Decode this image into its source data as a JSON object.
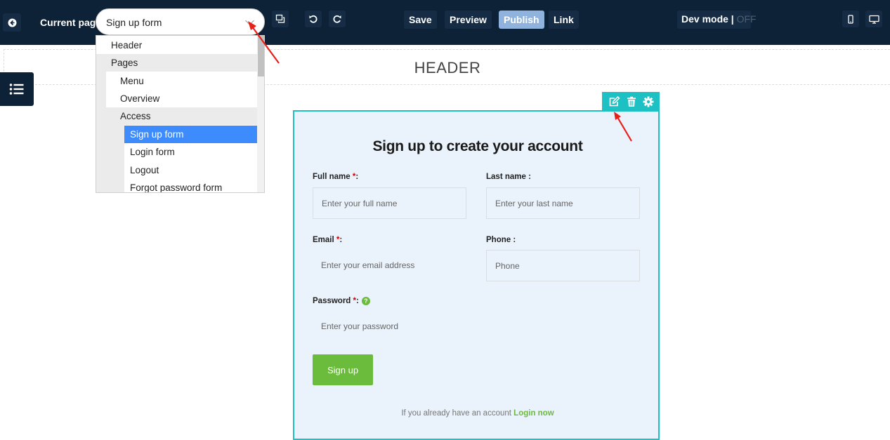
{
  "topbar": {
    "current_page_label": "Current page",
    "current_page_value": "Sign up form",
    "save_label": "Save",
    "preview_label": "Preview",
    "publish_label": "Publish",
    "link_label": "Link",
    "dev_mode_label": "Dev mode |",
    "dev_mode_state": "OFF"
  },
  "page_dropdown": {
    "items": [
      {
        "label": "Header",
        "level": 0
      },
      {
        "label": "Pages",
        "level": 0
      },
      {
        "label": "Menu",
        "level": 1
      },
      {
        "label": "Overview",
        "level": 1
      },
      {
        "label": "Access",
        "level": 1
      },
      {
        "label": "Sign up form",
        "level": 2,
        "selected": true
      },
      {
        "label": "Login form",
        "level": 2
      },
      {
        "label": "Logout",
        "level": 2
      },
      {
        "label": "Forgot password form",
        "level": 2
      }
    ]
  },
  "canvas": {
    "header_text": "HEADER"
  },
  "form": {
    "title": "Sign up to create your account",
    "full_name_label": "Full name",
    "full_name_placeholder": "Enter your full name",
    "last_name_label": "Last name :",
    "last_name_placeholder": "Enter your last name",
    "email_label": "Email",
    "email_placeholder": "Enter your email address",
    "phone_label": "Phone :",
    "phone_placeholder": "Phone",
    "password_label": "Password",
    "password_placeholder": "Enter your password",
    "required_mark": "*",
    "colon": ":",
    "help_glyph": "?",
    "signup_label": "Sign up",
    "already_text": "If you already have an account",
    "login_link": "Login now"
  },
  "colors": {
    "topbar": "#0d2137",
    "accent_teal": "#1ec1c3",
    "green": "#6bbb3d",
    "selected_blue": "#3d8bfd",
    "arrow_red": "#e8201c"
  },
  "icons": [
    "back-arrow-icon",
    "duplicate-icon",
    "undo-icon",
    "redo-icon",
    "mobile-icon",
    "desktop-icon",
    "list-icon",
    "edit-icon",
    "trash-icon",
    "gear-icon",
    "chevron-down-icon",
    "help-icon"
  ]
}
